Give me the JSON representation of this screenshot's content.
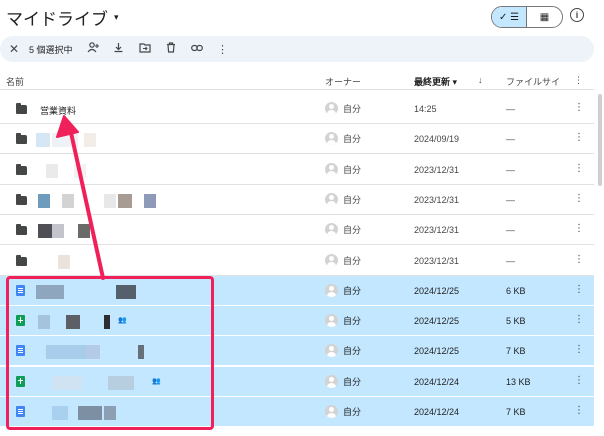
{
  "header": {
    "title": "マイドライブ",
    "title_caret": "▾",
    "view_list_icon": "✓ ☰",
    "view_grid_icon": "▦",
    "info_icon": "i"
  },
  "selection_bar": {
    "close": "✕",
    "count_label": "5 個選択中",
    "actions": [
      "add-person-icon",
      "download-icon",
      "move-to-folder-icon",
      "trash-icon",
      "link-icon",
      "more-vert-icon"
    ]
  },
  "columns": {
    "name": "名前",
    "owner": "オーナー",
    "modified": "最終更新",
    "modified_sort": "▾",
    "sort_direction": "↓",
    "filesize": "ファイルサイ",
    "more": "⋮"
  },
  "rows": [
    {
      "type": "folder",
      "name": "営業資料",
      "owner": "自分",
      "modified": "14:25",
      "size": "—",
      "selected": false
    },
    {
      "type": "folder",
      "name": "",
      "owner": "自分",
      "modified": "2024/09/19",
      "size": "—",
      "selected": false
    },
    {
      "type": "folder",
      "name": "",
      "owner": "自分",
      "modified": "2023/12/31",
      "size": "—",
      "selected": false
    },
    {
      "type": "folder",
      "name": "",
      "owner": "自分",
      "modified": "2023/12/31",
      "size": "—",
      "selected": false
    },
    {
      "type": "folder",
      "name": "",
      "owner": "自分",
      "modified": "2023/12/31",
      "size": "—",
      "selected": false
    },
    {
      "type": "folder",
      "name": "",
      "owner": "自分",
      "modified": "2023/12/31",
      "size": "—",
      "selected": false
    },
    {
      "type": "doc",
      "name": "",
      "owner": "自分",
      "modified": "2024/12/25",
      "size": "6 KB",
      "selected": true
    },
    {
      "type": "sheet",
      "name": "",
      "owner": "自分",
      "modified": "2024/12/25",
      "size": "5 KB",
      "selected": true
    },
    {
      "type": "doc",
      "name": "",
      "owner": "自分",
      "modified": "2024/12/25",
      "size": "7 KB",
      "selected": true
    },
    {
      "type": "sheet",
      "name": "",
      "owner": "自分",
      "modified": "2024/12/24",
      "size": "13 KB",
      "selected": true
    },
    {
      "type": "doc",
      "name": "",
      "owner": "自分",
      "modified": "2024/12/24",
      "size": "7 KB",
      "selected": true
    }
  ],
  "colors": {
    "selected_row": "#c2e7ff",
    "annotation": "#f0215a",
    "doc_icon": "#4285f4",
    "sheet_icon": "#0f9d58"
  }
}
